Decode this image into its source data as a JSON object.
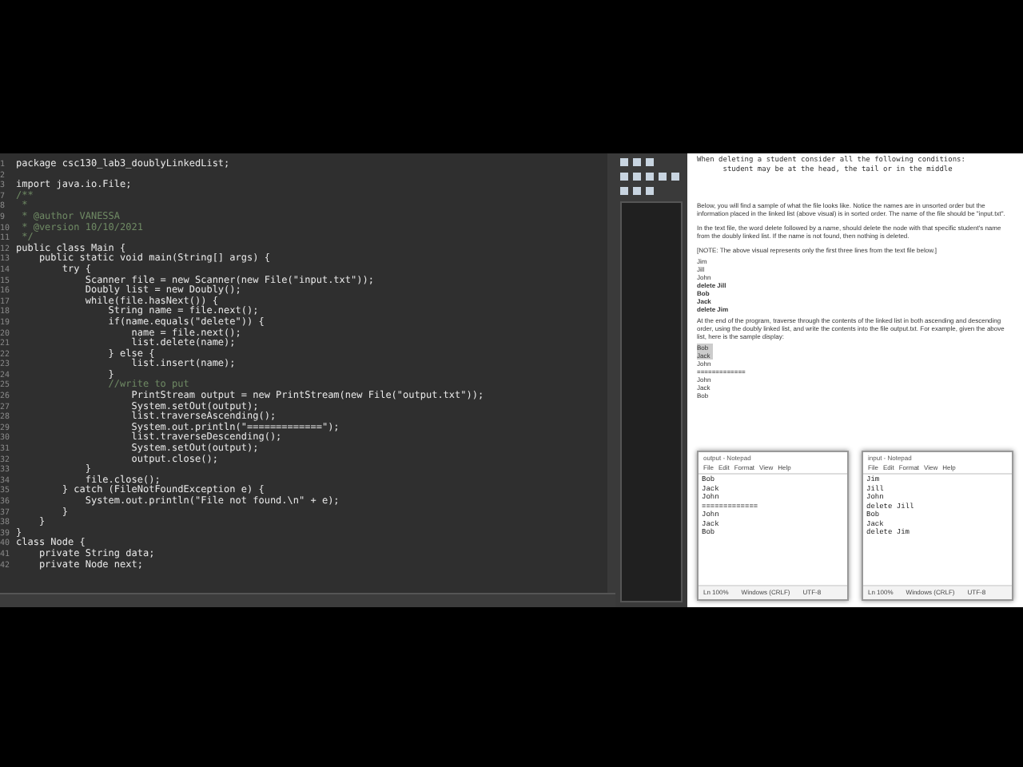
{
  "editor": {
    "lines": [
      {
        "number": "1",
        "text": "package csc130_lab3_doublyLinkedList;",
        "kind": "code"
      },
      {
        "number": "2"
      },
      {
        "number": "3",
        "text": "import java.io.File;",
        "kind": "code"
      },
      {
        "number": "7",
        "text": "/**",
        "kind": "comment"
      },
      {
        "number": "8",
        "text": " *",
        "kind": "comment"
      },
      {
        "number": "9",
        "text": " * @author VANESSA",
        "kind": "comment"
      },
      {
        "number": "10",
        "text": " * @version 10/10/2021",
        "kind": "comment"
      },
      {
        "number": "11",
        "text": " */",
        "kind": "comment"
      },
      {
        "number": "12",
        "text": "public class Main {",
        "kind": "code"
      },
      {
        "number": "13",
        "text": "    public static void main(String[] args) {",
        "kind": "code"
      },
      {
        "number": "14",
        "text": "        try {",
        "kind": "code"
      },
      {
        "number": "15",
        "text": "            Scanner file = new Scanner(new File(\"input.txt\"));",
        "kind": "code"
      },
      {
        "number": "16",
        "text": "            Doubly list = new Doubly();",
        "kind": "code"
      },
      {
        "number": "17",
        "text": "            while(file.hasNext()) {",
        "kind": "code"
      },
      {
        "number": "18",
        "text": "                String name = file.next();",
        "kind": "code"
      },
      {
        "number": "19",
        "text": "                if(name.equals(\"delete\")) {",
        "kind": "code"
      },
      {
        "number": "20",
        "text": "                    name = file.next();",
        "kind": "code"
      },
      {
        "number": "21",
        "text": "                    list.delete(name);",
        "kind": "code"
      },
      {
        "number": "22",
        "text": "                } else {",
        "kind": "code"
      },
      {
        "number": "23",
        "text": "                    list.insert(name);",
        "kind": "code"
      },
      {
        "number": "24",
        "text": "                }",
        "kind": "code"
      },
      {
        "number": "25",
        "text": "                //write to put",
        "kind": "comment"
      },
      {
        "number": "26",
        "text": "                    PrintStream output = new PrintStream(new File(\"output.txt\"));",
        "kind": "code"
      },
      {
        "number": "27",
        "text": "                    System.setOut(output);",
        "kind": "code"
      },
      {
        "number": "28",
        "text": "                    list.traverseAscending();",
        "kind": "code"
      },
      {
        "number": "29",
        "text": "                    System.out.println(\"=============\");",
        "kind": "code"
      },
      {
        "number": "30",
        "text": "                    list.traverseDescending();",
        "kind": "code"
      },
      {
        "number": "31",
        "text": "                    System.setOut(output);",
        "kind": "code"
      },
      {
        "number": "32",
        "text": "                    output.close();",
        "kind": "code"
      },
      {
        "number": "33",
        "text": "            }",
        "kind": "code"
      },
      {
        "number": "34",
        "text": "            file.close();",
        "kind": "code"
      },
      {
        "number": "35",
        "text": "        } catch (FileNotFoundException e) {",
        "kind": "code"
      },
      {
        "number": "36",
        "text": "            System.out.println(\"File not found.\\n\" + e);",
        "kind": "code"
      },
      {
        "number": "37",
        "text": "        }",
        "kind": "code"
      },
      {
        "number": "38",
        "text": "    }",
        "kind": "code"
      },
      {
        "number": "39",
        "text": "}",
        "kind": "code"
      },
      {
        "number": "40",
        "text": "class Node {",
        "kind": "code"
      },
      {
        "number": "41",
        "text": "    private String data;",
        "kind": "code"
      },
      {
        "number": "42",
        "text": "    private Node next;",
        "kind": "code"
      }
    ]
  },
  "document": {
    "blocks": [
      {
        "kind": "mono",
        "text": "When deleting a student consider all the following conditions:"
      },
      {
        "kind": "mono",
        "text": "      student may be at the head, the tail or in the middle"
      },
      {
        "kind": "gap"
      },
      {
        "kind": "para",
        "text": "Below, you will find a sample of what the file looks like. Notice the names are in unsorted order but the information placed in the linked list (above visual) is in sorted order. The name of the file should be \"input.txt\"."
      },
      {
        "kind": "para",
        "text": "In the text file, the word delete followed by a name, should delete the node with that specific student's name from the doubly linked list. If the name is not found, then nothing is deleted."
      },
      {
        "kind": "para",
        "text": "[NOTE: The above visual represents only the first three lines from the text file below.]"
      },
      {
        "kind": "line",
        "text": "Jim"
      },
      {
        "kind": "line",
        "text": "Jill"
      },
      {
        "kind": "line",
        "text": "John"
      },
      {
        "kind": "line",
        "text": "**delete Jill**"
      },
      {
        "kind": "line",
        "text": "**Bob**"
      },
      {
        "kind": "line",
        "text": "**Jack**"
      },
      {
        "kind": "line",
        "text": "**delete Jim**"
      },
      {
        "kind": "para",
        "text": "At the end of the program, traverse through the contents of the linked list in both ascending and descending order, using the doubly linked list, and write the contents into the file output.txt. For example, given the above list, here is the sample display:"
      },
      {
        "kind": "highlight",
        "text": "Bob"
      },
      {
        "kind": "highlight",
        "text": "Jack"
      },
      {
        "kind": "line",
        "text": "John"
      },
      {
        "kind": "line",
        "text": "============="
      },
      {
        "kind": "line",
        "text": "John"
      },
      {
        "kind": "line",
        "text": "Jack"
      },
      {
        "kind": "line",
        "text": "Bob"
      }
    ]
  },
  "notepads": [
    {
      "title": "output - Notepad",
      "menu": [
        "File",
        "Edit",
        "Format",
        "View",
        "Help"
      ],
      "lines": [
        "Bob",
        "Jack",
        "John",
        "=============",
        "John",
        "Jack",
        "Bob"
      ],
      "status": [
        "Ln 100%",
        "Windows (CRLF)",
        "UTF-8"
      ]
    },
    {
      "title": "input - Notepad",
      "menu": [
        "File",
        "Edit",
        "Format",
        "View",
        "Help"
      ],
      "lines": [
        "Jim",
        "Jill",
        "John",
        "delete Jill",
        "Bob",
        "Jack",
        "delete Jim"
      ],
      "status": [
        "Ln 100%",
        "Windows (CRLF)",
        "UTF-8"
      ]
    }
  ]
}
